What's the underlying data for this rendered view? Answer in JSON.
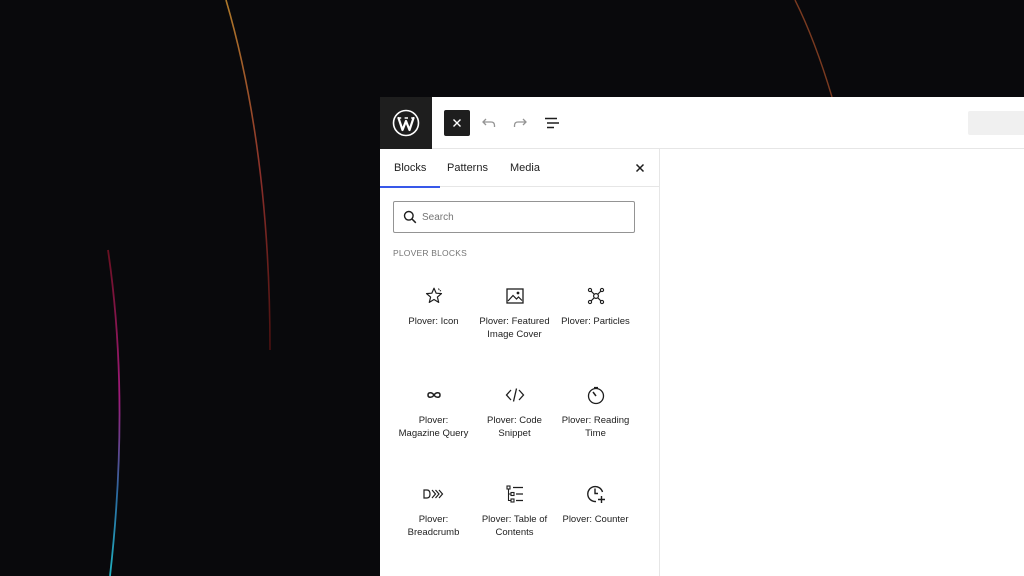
{
  "tabs": [
    {
      "label": "Blocks",
      "active": true
    },
    {
      "label": "Patterns",
      "active": false
    },
    {
      "label": "Media",
      "active": false
    }
  ],
  "search": {
    "placeholder": "Search",
    "value": ""
  },
  "section_title": "PLOVER BLOCKS",
  "blocks": [
    {
      "label": "Plover: Icon",
      "icon": "star-icon"
    },
    {
      "label": "Plover: Featured Image Cover",
      "icon": "image-icon"
    },
    {
      "label": "Plover: Particles",
      "icon": "particles-icon"
    },
    {
      "label": "Plover: Magazine Query",
      "icon": "loop-icon"
    },
    {
      "label": "Plover: Code Snippet",
      "icon": "code-icon"
    },
    {
      "label": "Plover: Reading Time",
      "icon": "timer-icon"
    },
    {
      "label": "Plover: Breadcrumb",
      "icon": "breadcrumb-icon"
    },
    {
      "label": "Plover: Table of Contents",
      "icon": "toc-icon"
    },
    {
      "label": "Plover: Counter",
      "icon": "counter-icon"
    }
  ],
  "colors": {
    "accent": "#3858e9",
    "toolbar_dark": "#1e1e1e",
    "background": "#09090c"
  },
  "icons": {
    "logo": "wordpress-logo-icon",
    "close": "close-icon",
    "undo": "undo-icon",
    "redo": "redo-icon",
    "outline": "document-overview-icon",
    "search": "search-icon"
  }
}
